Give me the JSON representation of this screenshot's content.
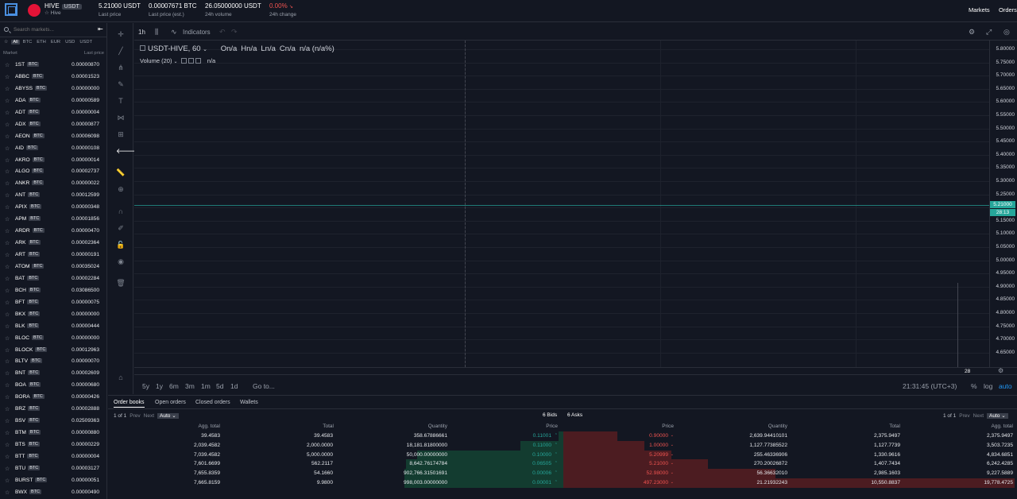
{
  "header": {
    "pair_symbol": "HIVE",
    "pair_quote": "USDT",
    "pair_name": "Hive",
    "last_price": "5.21000 USDT",
    "last_price_label": "Last price",
    "last_price_est": "0.00007671 BTC",
    "last_price_est_label": "Last price (est.)",
    "volume": "26.05000000 USDT",
    "volume_label": "24h volume",
    "change": "0.00%",
    "change_label": "24h change",
    "nav_markets": "Markets",
    "nav_orders": "Orders"
  },
  "sidebar": {
    "search_placeholder": "Search markets...",
    "collapse_icon": "collapse-left-icon",
    "filters": [
      "All",
      "BTC",
      "ETH",
      "EUR",
      "USD",
      "USDT"
    ],
    "col_market": "Market",
    "col_last_price": "Last price",
    "markets": [
      {
        "sym": "1ST",
        "cur": "BTC",
        "price": "0.00000870"
      },
      {
        "sym": "ABBC",
        "cur": "BTC",
        "price": "0.00001523"
      },
      {
        "sym": "ABYSS",
        "cur": "BTC",
        "price": "0.00000000"
      },
      {
        "sym": "ADA",
        "cur": "BTC",
        "price": "0.00000589"
      },
      {
        "sym": "ADT",
        "cur": "BTC",
        "price": "0.00000004"
      },
      {
        "sym": "ADX",
        "cur": "BTC",
        "price": "0.00000877"
      },
      {
        "sym": "AEON",
        "cur": "BTC",
        "price": "0.00006098"
      },
      {
        "sym": "AID",
        "cur": "BTC",
        "price": "0.00000108"
      },
      {
        "sym": "AKRO",
        "cur": "BTC",
        "price": "0.00000014"
      },
      {
        "sym": "ALGO",
        "cur": "BTC",
        "price": "0.00002737"
      },
      {
        "sym": "ANKR",
        "cur": "BTC",
        "price": "0.00000022"
      },
      {
        "sym": "ANT",
        "cur": "BTC",
        "price": "0.00012599"
      },
      {
        "sym": "APIX",
        "cur": "BTC",
        "price": "0.00000348"
      },
      {
        "sym": "APM",
        "cur": "BTC",
        "price": "0.00001856"
      },
      {
        "sym": "ARDR",
        "cur": "BTC",
        "price": "0.00000470"
      },
      {
        "sym": "ARK",
        "cur": "BTC",
        "price": "0.00002364"
      },
      {
        "sym": "ART",
        "cur": "BTC",
        "price": "0.00000191"
      },
      {
        "sym": "ATOM",
        "cur": "BTC",
        "price": "0.00035024"
      },
      {
        "sym": "BAT",
        "cur": "BTC",
        "price": "0.00002284"
      },
      {
        "sym": "BCH",
        "cur": "BTC",
        "price": "0.03086500"
      },
      {
        "sym": "BFT",
        "cur": "BTC",
        "price": "0.00000075"
      },
      {
        "sym": "BKX",
        "cur": "BTC",
        "price": "0.00000000"
      },
      {
        "sym": "BLK",
        "cur": "BTC",
        "price": "0.00000444"
      },
      {
        "sym": "BLOC",
        "cur": "BTC",
        "price": "0.00000000"
      },
      {
        "sym": "BLOCK",
        "cur": "BTC",
        "price": "0.00012963"
      },
      {
        "sym": "BLTV",
        "cur": "BTC",
        "price": "0.00000070"
      },
      {
        "sym": "BNT",
        "cur": "BTC",
        "price": "0.00002609"
      },
      {
        "sym": "BOA",
        "cur": "BTC",
        "price": "0.00000680"
      },
      {
        "sym": "BORA",
        "cur": "BTC",
        "price": "0.00000426"
      },
      {
        "sym": "BRZ",
        "cur": "BTC",
        "price": "0.00002888"
      },
      {
        "sym": "BSV",
        "cur": "BTC",
        "price": "0.02509363"
      },
      {
        "sym": "BTM",
        "cur": "BTC",
        "price": "0.00000880"
      },
      {
        "sym": "BTS",
        "cur": "BTC",
        "price": "0.00000229"
      },
      {
        "sym": "BTT",
        "cur": "BTC",
        "price": "0.00000004"
      },
      {
        "sym": "BTU",
        "cur": "BTC",
        "price": "0.00003127"
      },
      {
        "sym": "BURST",
        "cur": "BTC",
        "price": "0.00000051"
      },
      {
        "sym": "BWX",
        "cur": "BTC",
        "price": "0.00000490"
      }
    ]
  },
  "chart": {
    "timeframe": "1h",
    "indicators_label": "Indicators",
    "symbol_interval": "USDT-HIVE, 60",
    "ohlc": [
      "On/a",
      "Hn/a",
      "Ln/a",
      "Cn/a",
      "n/a (n/a%)"
    ],
    "volume_label": "Volume (20)",
    "volume_value": "n/a",
    "y_ticks": [
      "5.80000",
      "5.75000",
      "5.70000",
      "5.65000",
      "5.60000",
      "5.55000",
      "5.50000",
      "5.45000",
      "5.40000",
      "5.35000",
      "5.30000",
      "5.25000",
      "5.20000",
      "5.15000",
      "5.10000",
      "5.05000",
      "5.00000",
      "4.95000",
      "4.90000",
      "4.85000",
      "4.80000",
      "4.75000",
      "4.70000",
      "4.65000"
    ],
    "current_price": "5.21000",
    "countdown": "28:13",
    "x_label": "28",
    "ranges": [
      "5y",
      "1y",
      "6m",
      "3m",
      "1m",
      "5d",
      "1d"
    ],
    "goto_label": "Go to...",
    "time": "21:31:45 (UTC+3)",
    "percent_label": "%",
    "log_label": "log",
    "auto_label": "auto",
    "accent": "#26a69a"
  },
  "orders": {
    "tabs": [
      "Order books",
      "Open orders",
      "Closed orders",
      "Wallets"
    ],
    "bids_pagination": "1 of 1",
    "asks_pagination": "1 of 1",
    "prev": "Prev",
    "next": "Next",
    "select_value": "Auto",
    "bids_count": "6 Bids",
    "asks_count": "6 Asks",
    "bid_headers": [
      "Agg. total",
      "Total",
      "Quantity",
      "Price"
    ],
    "ask_headers": [
      "Price",
      "Quantity",
      "Total",
      "Agg. total"
    ],
    "bids": [
      {
        "agg": "39.4583",
        "total": "39.4583",
        "qty": "358.67886661",
        "price": "0.11001",
        "depth": 0.03
      },
      {
        "agg": "2,039.4582",
        "total": "2,000.0000",
        "qty": "18,181.81800000",
        "price": "0.11000",
        "depth": 0.27
      },
      {
        "agg": "7,039.4582",
        "total": "5,000.0000",
        "qty": "50,000.00000000",
        "price": "0.10000",
        "depth": 0.92
      },
      {
        "agg": "7,601.6699",
        "total": "562.2117",
        "qty": "8,642.76174784",
        "price": "0.06505",
        "depth": 0.99
      },
      {
        "agg": "7,655.8359",
        "total": "54.1660",
        "qty": "902,766.31501691",
        "price": "0.00006",
        "depth": 1.0
      },
      {
        "agg": "7,665.8159",
        "total": "9.9800",
        "qty": "998,003.00000000",
        "price": "0.00001",
        "depth": 1.0
      }
    ],
    "asks": [
      {
        "price": "0.90000",
        "qty": "2,639.94410101",
        "total": "2,375.9497",
        "agg": "2,375.9497",
        "depth": 0.12
      },
      {
        "price": "1.00000",
        "qty": "1,127.77385522",
        "total": "1,127.7739",
        "agg": "3,503.7235",
        "depth": 0.18
      },
      {
        "price": "5.20999",
        "qty": "255.46336906",
        "total": "1,330.9616",
        "agg": "4,834.6851",
        "depth": 0.24
      },
      {
        "price": "5.21000",
        "qty": "270.20026872",
        "total": "1,407.7434",
        "agg": "6,242.4285",
        "depth": 0.32
      },
      {
        "price": "52.98000",
        "qty": "56.36632010",
        "total": "2,985.1603",
        "agg": "9,227.5889",
        "depth": 0.47
      },
      {
        "price": "497.23000",
        "qty": "21.21932243",
        "total": "10,550.8837",
        "agg": "19,778.4725",
        "depth": 1.0
      }
    ]
  }
}
